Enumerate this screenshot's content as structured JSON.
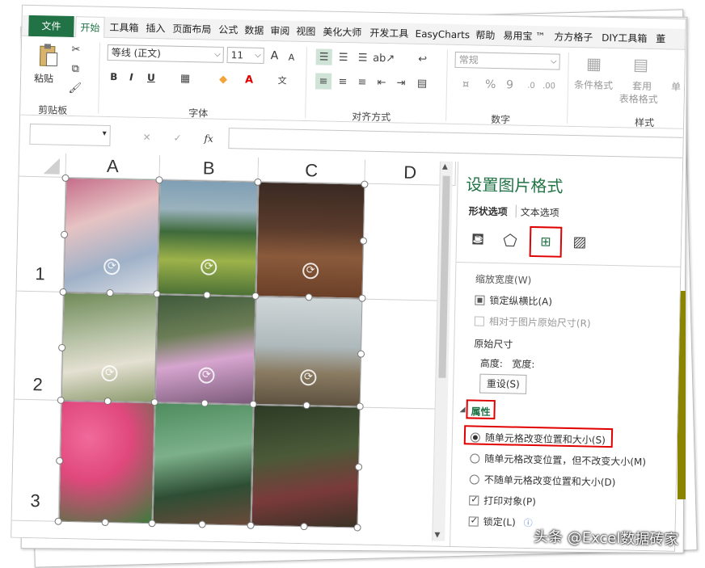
{
  "ribbon_tabs": [
    "文件",
    "开始",
    "工具箱",
    "插入",
    "页面布局",
    "公式",
    "数据",
    "审阅",
    "视图",
    "美化大师",
    "开发工具",
    "EasyCharts",
    "帮助",
    "易用宝 ™",
    "方方格子",
    "DIY工具箱",
    "董"
  ],
  "clipboard": {
    "paste": "粘贴",
    "group": "剪贴板"
  },
  "font": {
    "name": "等线 (正文)",
    "size": "11",
    "group": "字体",
    "bold": "B",
    "italic": "I",
    "underline": "U",
    "grow": "A",
    "shrink": "A"
  },
  "alignment": {
    "group": "对齐方式"
  },
  "number": {
    "format": "常规",
    "group": "数字",
    "percent": "%",
    "comma": "9"
  },
  "styles": {
    "cond": "条件格式",
    "table": "套用",
    "table2": "表格格式",
    "cell": "单",
    "group": "样式"
  },
  "formula_bar": {
    "fx": "fx",
    "cancel": "✕",
    "enter": "✓"
  },
  "columns": [
    "A",
    "B",
    "C",
    "D"
  ],
  "rows": [
    "1",
    "2",
    "3"
  ],
  "pane": {
    "title": "设置图片格式",
    "tab_shape": "形状选项",
    "tab_text": "文本选项",
    "scale_width": "缩放宽度(W)",
    "lock_ratio": "锁定纵横比(A)",
    "relative_original": "相对于图片原始尺寸(R)",
    "original_size": "原始尺寸",
    "height_width": "高度:   宽度:",
    "reset": "重设(S)",
    "properties": "属性",
    "opt1": "随单元格改变位置和大小(S)",
    "opt2": "随单元格改变位置，但不改变大小(M)",
    "opt3": "不随单元格改变位置和大小(D)",
    "print_obj": "打印对象(P)",
    "locked": "锁定(L)"
  },
  "watermark": "头条 @Excel数据砖家",
  "colors": {
    "excel_green": "#217346",
    "highlight_red": "#e00000"
  }
}
